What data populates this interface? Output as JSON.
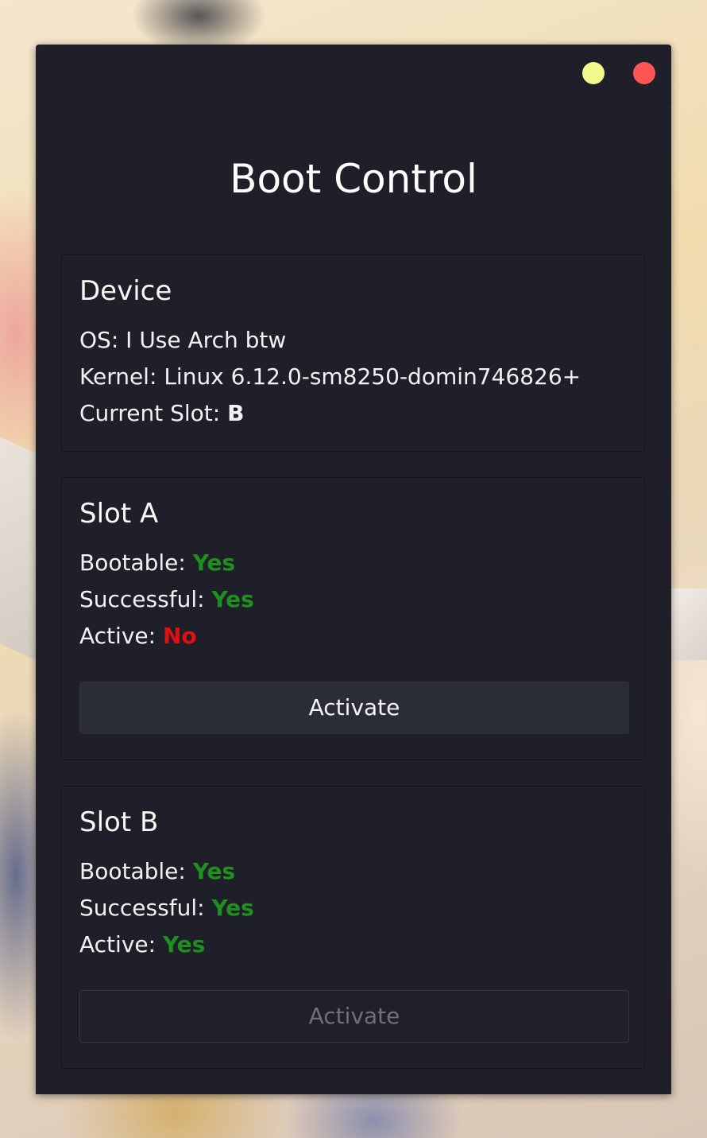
{
  "window": {
    "title": "Boot Control",
    "controls": {
      "minimize_color": "#f1fa8c",
      "close_color": "#ff5555"
    }
  },
  "device": {
    "heading": "Device",
    "os_label": "OS: ",
    "os_value": "I Use Arch btw",
    "kernel_label": "Kernel: ",
    "kernel_value": "Linux 6.12.0-sm8250-domin746826+",
    "current_slot_label": "Current Slot: ",
    "current_slot_value": "B"
  },
  "slot_a": {
    "heading": "Slot A",
    "bootable_label": "Bootable: ",
    "bootable_value": "Yes",
    "successful_label": "Successful: ",
    "successful_value": "Yes",
    "active_label": "Active: ",
    "active_value": "No",
    "button_label": "Activate",
    "button_enabled": true
  },
  "slot_b": {
    "heading": "Slot B",
    "bootable_label": "Bootable: ",
    "bootable_value": "Yes",
    "successful_label": "Successful: ",
    "successful_value": "Yes",
    "active_label": "Active: ",
    "active_value": "Yes",
    "button_label": "Activate",
    "button_enabled": false
  },
  "colors": {
    "yes": "#1f8f1f",
    "no": "#e01010",
    "window_bg": "#1e1f28"
  }
}
